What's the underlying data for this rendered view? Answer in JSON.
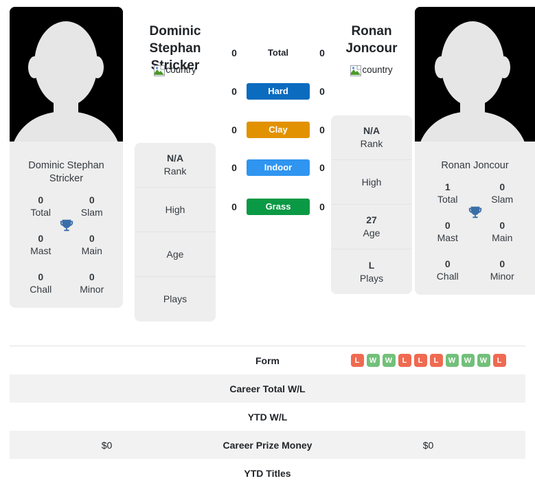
{
  "players": {
    "left": {
      "header_name": "Dominic Stephan Stricker",
      "card_name": "Dominic Stephan Stricker",
      "flag_alt": "country",
      "avatar_icon": "person-silhouette-icon",
      "titles": [
        {
          "value": "0",
          "label": "Total"
        },
        {
          "value": "0",
          "label": "Slam"
        },
        {
          "value": "0",
          "label": "Mast"
        },
        {
          "value": "0",
          "label": "Main"
        },
        {
          "value": "0",
          "label": "Chall"
        },
        {
          "value": "0",
          "label": "Minor"
        }
      ],
      "info": [
        {
          "value": "N/A",
          "label": "Rank"
        },
        {
          "value": "",
          "label": "High"
        },
        {
          "value": "",
          "label": "Age"
        },
        {
          "value": "",
          "label": "Plays"
        }
      ]
    },
    "right": {
      "header_name": "Ronan Joncour",
      "card_name": "Ronan Joncour",
      "flag_alt": "country",
      "avatar_icon": "person-silhouette-icon",
      "titles": [
        {
          "value": "1",
          "label": "Total"
        },
        {
          "value": "0",
          "label": "Slam"
        },
        {
          "value": "0",
          "label": "Mast"
        },
        {
          "value": "0",
          "label": "Main"
        },
        {
          "value": "0",
          "label": "Chall"
        },
        {
          "value": "0",
          "label": "Minor"
        }
      ],
      "info": [
        {
          "value": "N/A",
          "label": "Rank"
        },
        {
          "value": "",
          "label": "High"
        },
        {
          "value": "27",
          "label": "Age"
        },
        {
          "value": "L",
          "label": "Plays"
        }
      ]
    }
  },
  "h2h": [
    {
      "label": "Total",
      "left": "0",
      "right": "0",
      "style": "plain",
      "color": ""
    },
    {
      "label": "Hard",
      "left": "0",
      "right": "0",
      "style": "badge",
      "color": "#0b6bbf"
    },
    {
      "label": "Clay",
      "left": "0",
      "right": "0",
      "style": "badge",
      "color": "#e29200"
    },
    {
      "label": "Indoor",
      "left": "0",
      "right": "0",
      "style": "badge",
      "color": "#2f95f0"
    },
    {
      "label": "Grass",
      "left": "0",
      "right": "0",
      "style": "badge",
      "color": "#0a9944"
    }
  ],
  "bottom_rows": [
    {
      "label": "Form",
      "left": "",
      "right": "",
      "striped": false,
      "form": [
        "L",
        "W",
        "W",
        "L",
        "L",
        "L",
        "W",
        "W",
        "W",
        "L"
      ]
    },
    {
      "label": "Career Total W/L",
      "left": "",
      "right": "",
      "striped": true,
      "form": []
    },
    {
      "label": "YTD W/L",
      "left": "",
      "right": "",
      "striped": false,
      "form": []
    },
    {
      "label": "Career Prize Money",
      "left": "$0",
      "right": "$0",
      "striped": true,
      "form": []
    },
    {
      "label": "YTD Titles",
      "left": "",
      "right": "",
      "striped": false,
      "form": []
    }
  ],
  "form_colors": {
    "W": "#72c07a",
    "L": "#ef6a51"
  },
  "trophy_color": "#3a6ea8"
}
